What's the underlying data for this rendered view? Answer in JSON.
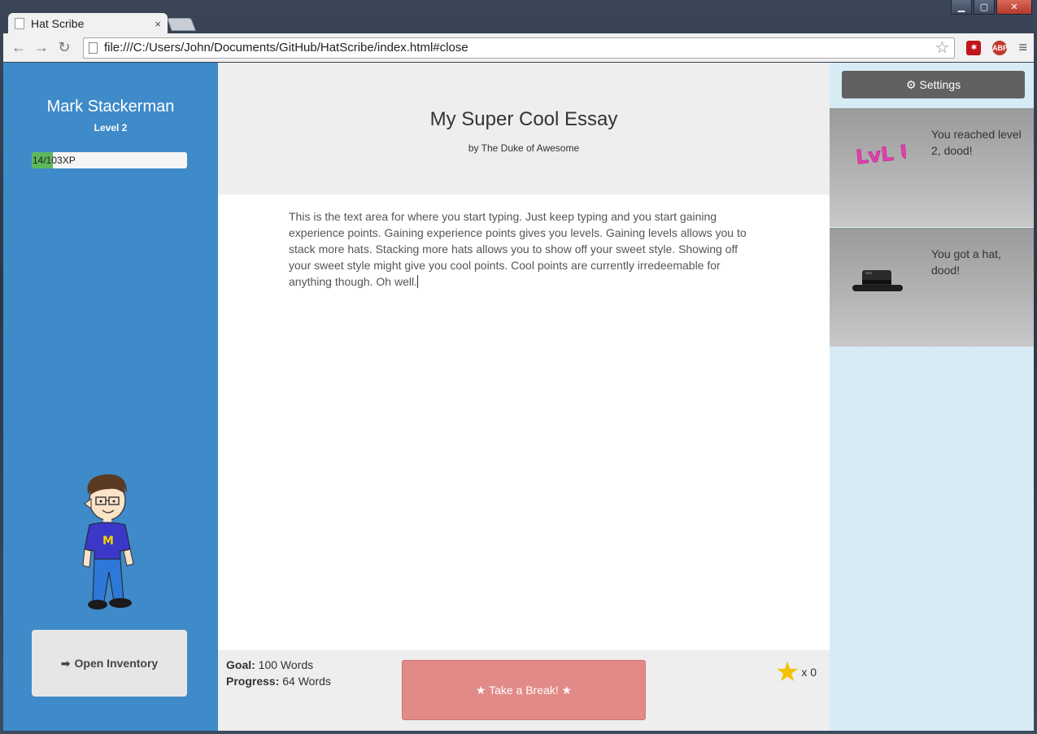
{
  "browser": {
    "tab_title": "Hat Scribe",
    "tab_close": "×",
    "url": "file:///C:/Users/John/Documents/GitHub/HatScribe/index.html#close",
    "ext_lastpass": "✱",
    "ext_abp": "ABP",
    "window_controls": {
      "minimize": "▁",
      "maximize": "▢",
      "close": "✕"
    }
  },
  "user": {
    "name": "Mark Stackerman",
    "level": "Level 2",
    "xp_text": "14/103XP",
    "xp_progress": 0.136
  },
  "inventory": {
    "label": "Open Inventory",
    "icon": "arrow-right-icon"
  },
  "essay": {
    "title": "My Super Cool Essay",
    "author": "by The Duke of Awesome",
    "body": "This is the text area for where you start typing. Just keep typing and you start gaining experience points. Gaining experience points gives you levels. Gaining levels allows you to stack more hats. Stacking more hats allows you to show off your sweet style. Showing off your sweet style might give you cool points. Cool points are currently irredeemable for anything though. Oh well."
  },
  "footer": {
    "goal_label": "Goal:",
    "goal_value": "100 Words",
    "progress_label": "Progress:",
    "progress_value": "64 Words",
    "break_button": "★ Take a Break! ★",
    "stars_count": "x 0"
  },
  "sidebar": {
    "settings_label": "Settings",
    "notifications": [
      {
        "text": "You reached level 2, dood!",
        "image": "level-up-icon",
        "image_text": "LvL UP"
      },
      {
        "text": "You got a hat, dood!",
        "image": "hat-icon"
      }
    ]
  },
  "colors": {
    "left_panel": "#3f8ac9",
    "xp_fill": "#5cb85c",
    "break_button": "#e28a87",
    "right_panel": "#d7ebf5",
    "settings_button": "#616161",
    "star": "#f2c200"
  }
}
